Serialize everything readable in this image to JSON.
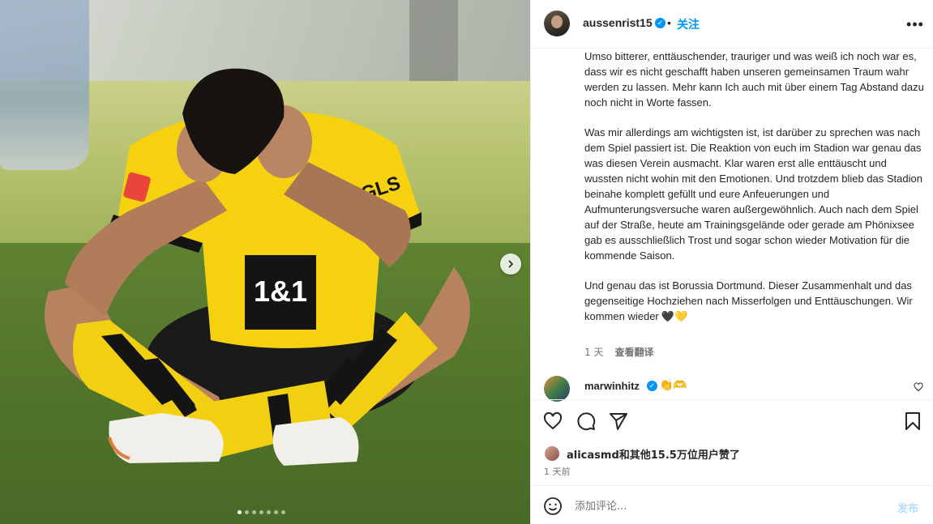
{
  "post": {
    "username": "aussenrist15",
    "follow_label": "关注",
    "separator": "•",
    "more_label": "•••"
  },
  "media": {
    "kit_sponsor": "GLS",
    "shirt_sponsor": "1&1",
    "slide_count": 7,
    "active_slide": 1
  },
  "caption": {
    "paragraphs": [
      "Umso bitterer, enttäuschender, trauriger und was weiß ich noch war es, dass wir es nicht geschafft haben unseren gemeinsamen Traum wahr werden zu lassen. Mehr kann Ich auch mit über einem Tag Abstand dazu noch nicht in Worte fassen.",
      "Was mir allerdings am wichtigsten ist, ist darüber zu sprechen was nach dem Spiel passiert ist. Die Reaktion von euch im Stadion war genau das was diesen Verein ausmacht. Klar waren erst alle enttäuscht und wussten nicht wohin mit den Emotionen. Und trotzdem blieb das Stadion beinahe komplett gefüllt und eure Anfeuerungen und Aufmunterungsversuche waren außergewöhnlich. Auch nach dem Spiel auf der Straße, heute am Trainingsgelände oder gerade am Phönixsee gab es ausschließlich Trost und sogar schon wieder Motivation für die kommende Saison.",
      "Und genau das ist Borussia Dortmund. Dieser Zusammenhalt und das gegenseitige Hochziehen nach Misserfolgen und Enttäuschungen. Wir kommen wieder"
    ],
    "hearts": [
      "🖤",
      "💛"
    ],
    "age": "1 天",
    "translate_label": "查看翻译"
  },
  "comment": {
    "username": "marwinhitz",
    "text": "👏🫶"
  },
  "likes": {
    "text": "alicasmd和其他15.5万位用户赞了",
    "time_ago": "1 天前"
  },
  "composer": {
    "placeholder": "添加评论...",
    "post_label": "发布"
  },
  "icons": {
    "verified": "verified-badge-icon",
    "like": "heart-icon",
    "comment": "comment-bubble-icon",
    "share": "paper-plane-icon",
    "save": "bookmark-icon",
    "emoji": "smiley-icon",
    "next": "chevron-right-icon"
  },
  "colors": {
    "accent": "#0095f6",
    "kit_yellow": "#f5d10f",
    "kit_black": "#141414"
  }
}
